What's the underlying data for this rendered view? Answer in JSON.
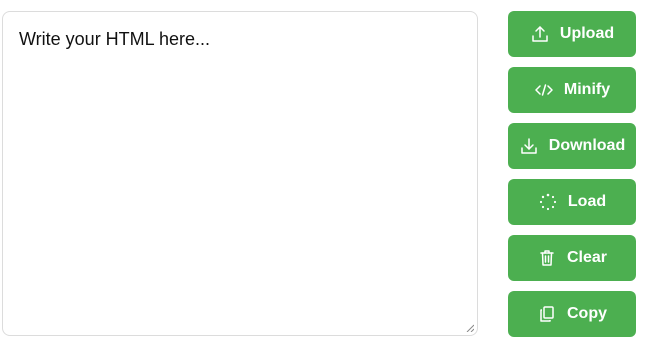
{
  "editor": {
    "placeholder": "Write your HTML here...",
    "value": ""
  },
  "toolbar": {
    "accent_color": "#4caf50",
    "buttons": [
      {
        "label": "Upload",
        "icon": "upload-icon"
      },
      {
        "label": "Minify",
        "icon": "code-icon"
      },
      {
        "label": "Download",
        "icon": "download-icon"
      },
      {
        "label": "Load",
        "icon": "loading-spinner-icon"
      },
      {
        "label": "Clear",
        "icon": "trash-icon"
      },
      {
        "label": "Copy",
        "icon": "copy-icon"
      }
    ]
  }
}
